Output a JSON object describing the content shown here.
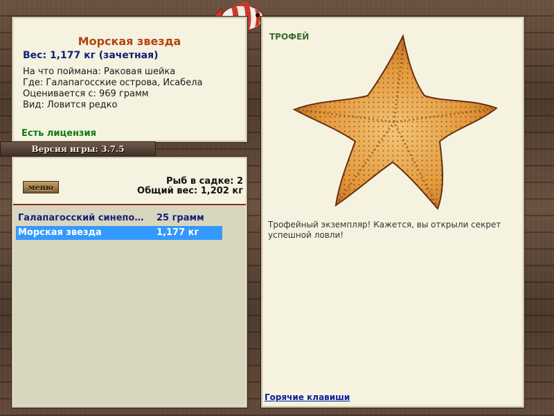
{
  "catch_info": {
    "name": "Морская звезда",
    "weight": "Вес: 1,177 кг (зачетная)",
    "caught_on": "На что поймана: Раковая шейка",
    "location": "Где: Галапагосские острова, Исабела",
    "valued_from": "Оценивается с: 969 грамм",
    "rarity": "Вид: Ловится редко",
    "license": "Есть лицензия"
  },
  "version": "Версия игры: 3.7.5",
  "menu_label": "меню",
  "keepnet": {
    "count": "Рыб в садке: 2",
    "total_weight": "Общий вес: 1,202 кг"
  },
  "catches": [
    {
      "name": "Галапагосский синепо…",
      "weight": "25 грамм"
    },
    {
      "name": "Морская звезда",
      "weight": "1,177 кг"
    }
  ],
  "trophy": {
    "label": "ТРОФЕЙ",
    "text": "Трофейный экземпляр! Кажется, вы открыли секрет успешной ловли!"
  },
  "hotkeys_link": "Горячие клавиши",
  "colors": {
    "title": "#b5440f",
    "weight": "#0f1f78",
    "license": "#0d7a12",
    "selection": "#3399ff",
    "starfish": "#e89a3c"
  }
}
